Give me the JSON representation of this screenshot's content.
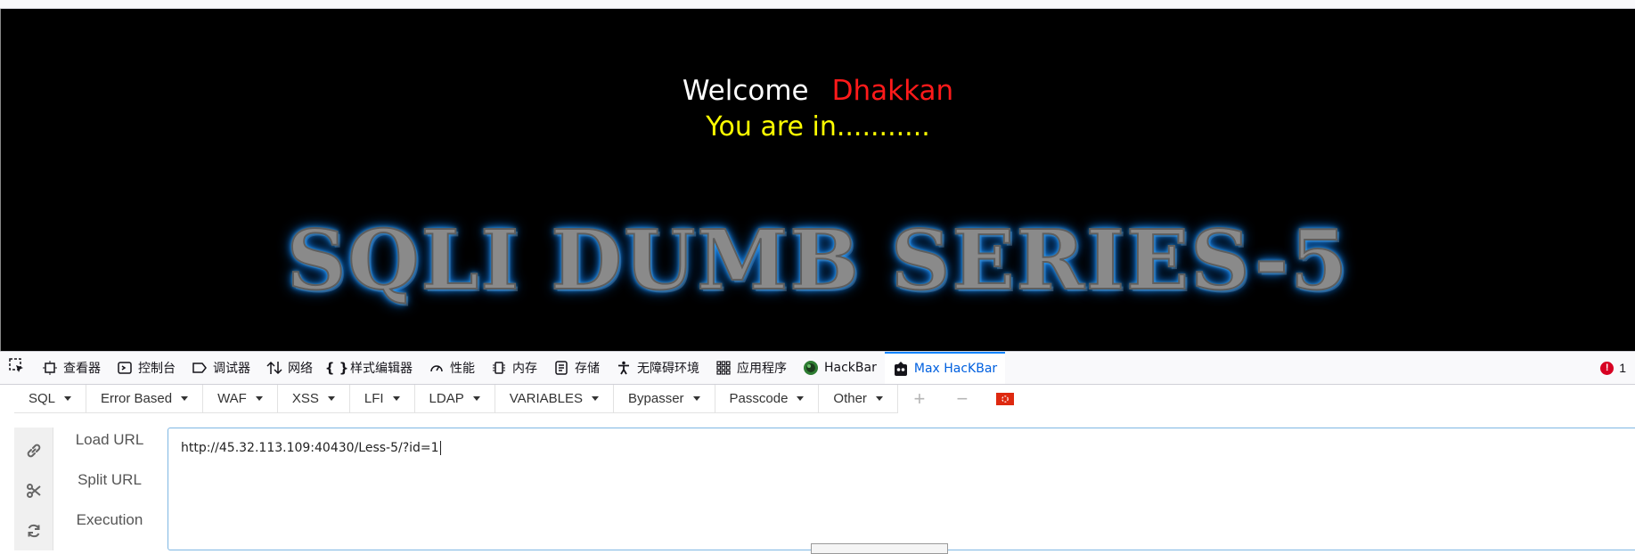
{
  "page": {
    "welcome": "Welcome",
    "username": "Dhakkan",
    "status": "You are in...........",
    "banner": "SQLI DUMB SERIES-5"
  },
  "devtools": {
    "tabs": [
      {
        "label": "查看器",
        "icon": "inspector-icon"
      },
      {
        "label": "控制台",
        "icon": "console-icon"
      },
      {
        "label": "调试器",
        "icon": "debugger-icon"
      },
      {
        "label": "网络",
        "icon": "network-icon"
      },
      {
        "label": "样式编辑器",
        "icon": "style-editor-icon"
      },
      {
        "label": "性能",
        "icon": "performance-icon"
      },
      {
        "label": "内存",
        "icon": "memory-icon"
      },
      {
        "label": "存储",
        "icon": "storage-icon"
      },
      {
        "label": "无障碍环境",
        "icon": "accessibility-icon"
      },
      {
        "label": "应用程序",
        "icon": "application-icon"
      },
      {
        "label": "HackBar",
        "icon": "hackbar-icon"
      },
      {
        "label": "Max HacKBar",
        "icon": "max-hackbar-icon"
      }
    ],
    "error_count": "1"
  },
  "hackbar": {
    "menus": [
      {
        "label": "SQL"
      },
      {
        "label": "Error Based"
      },
      {
        "label": "WAF"
      },
      {
        "label": "XSS"
      },
      {
        "label": "LFI"
      },
      {
        "label": "LDAP"
      },
      {
        "label": "VARIABLES"
      },
      {
        "label": "Bypasser"
      },
      {
        "label": "Passcode"
      },
      {
        "label": "Other"
      }
    ],
    "actions": {
      "load": "Load URL",
      "split": "Split URL",
      "execute": "Execution"
    },
    "url_value": "http://45.32.113.109:40430/Less-5/?id=1"
  },
  "colors": {
    "username": "#ff1a1a",
    "status": "#ffff00",
    "active_tab": "#0060df",
    "banner_glow": "#1e90ff"
  }
}
